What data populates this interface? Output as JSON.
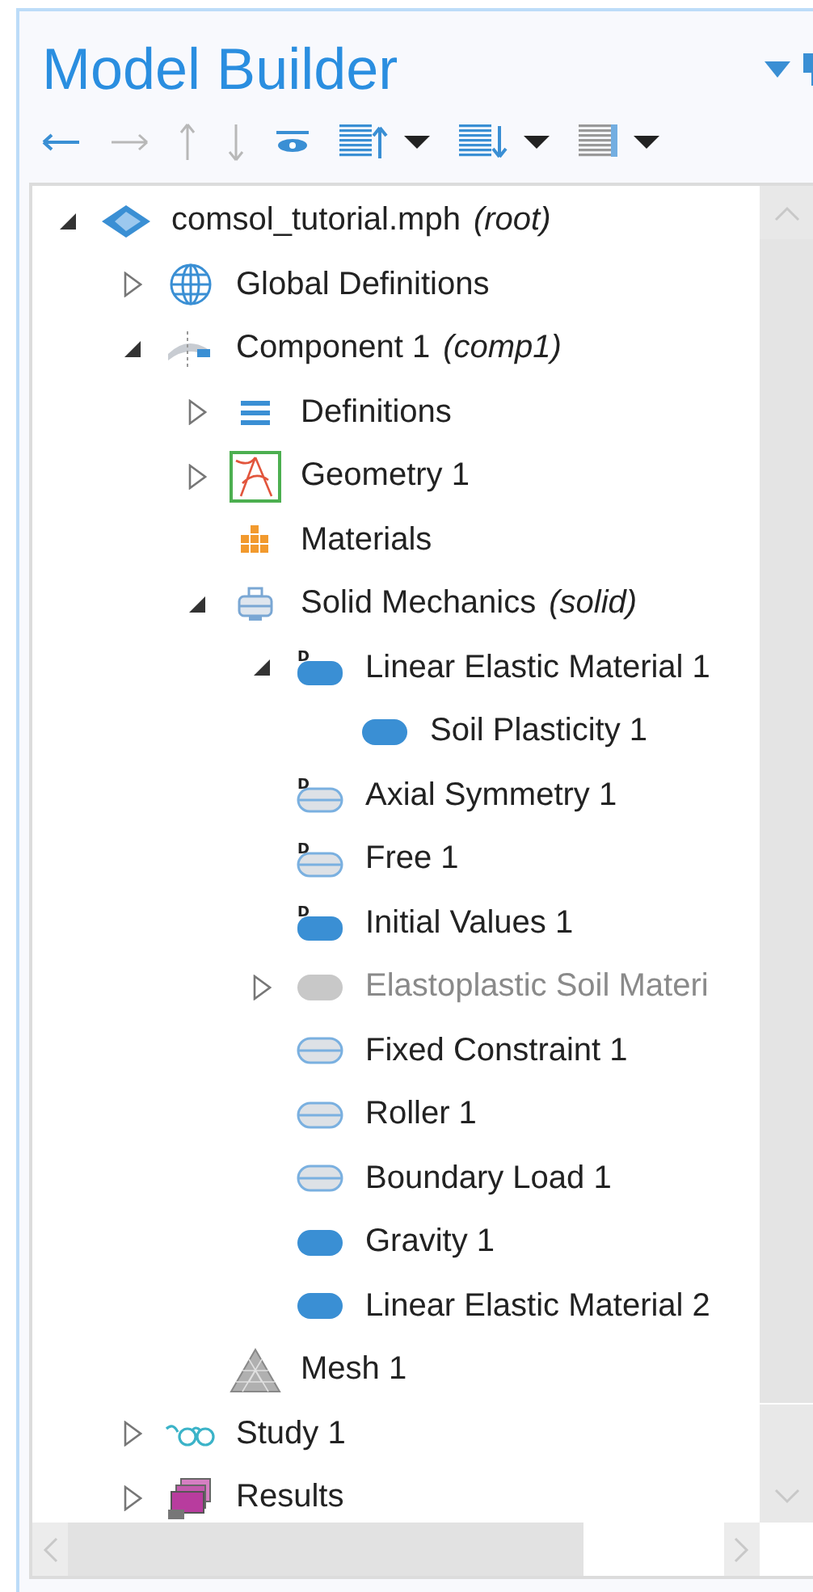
{
  "panel": {
    "title": "Model Builder"
  },
  "tree": [
    {
      "label": "comsol_tutorial.mph",
      "suffix": "(root)",
      "kind": "root",
      "expanded": true,
      "children": [
        {
          "label": "Global Definitions",
          "kind": "globe",
          "expanded": false
        },
        {
          "label": "Component 1",
          "suffix": "(comp1)",
          "kind": "component",
          "expanded": true,
          "children": [
            {
              "label": "Definitions",
              "kind": "definitions",
              "expanded": false
            },
            {
              "label": "Geometry 1",
              "kind": "geometry",
              "expanded": false
            },
            {
              "label": "Materials",
              "kind": "materials"
            },
            {
              "label": "Solid Mechanics",
              "suffix": "(solid)",
              "kind": "physics",
              "expanded": true,
              "children": [
                {
                  "label": "Linear Elastic Material 1",
                  "kind": "domain-default",
                  "badge": "D",
                  "expanded": true,
                  "children": [
                    {
                      "label": "Soil Plasticity 1",
                      "kind": "domain"
                    }
                  ]
                },
                {
                  "label": "Axial Symmetry 1",
                  "kind": "boundary-default",
                  "badge": "D"
                },
                {
                  "label": "Free 1",
                  "kind": "boundary-default",
                  "badge": "D"
                },
                {
                  "label": "Initial Values 1",
                  "kind": "domain-default",
                  "badge": "D"
                },
                {
                  "label": "Elastoplastic Soil Materi",
                  "kind": "domain",
                  "expanded": false,
                  "disabled": true
                },
                {
                  "label": "Fixed Constraint 1",
                  "kind": "boundary"
                },
                {
                  "label": "Roller 1",
                  "kind": "boundary"
                },
                {
                  "label": "Boundary Load 1",
                  "kind": "boundary"
                },
                {
                  "label": "Gravity 1",
                  "kind": "domain"
                },
                {
                  "label": "Linear Elastic Material 2",
                  "kind": "domain"
                }
              ]
            },
            {
              "label": "Mesh 1",
              "kind": "mesh"
            }
          ]
        },
        {
          "label": "Study 1",
          "kind": "study",
          "expanded": false
        },
        {
          "label": "Results",
          "kind": "results",
          "expanded": false
        }
      ]
    }
  ]
}
